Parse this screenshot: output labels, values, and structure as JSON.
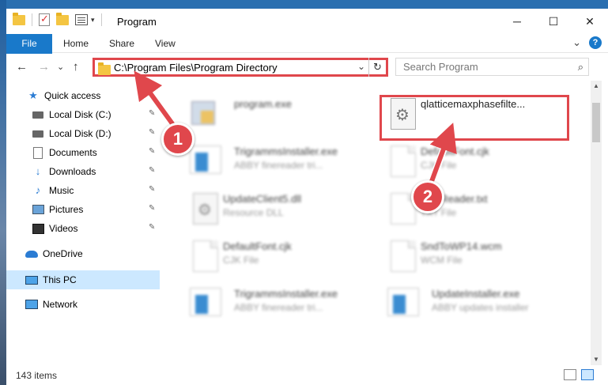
{
  "window": {
    "title": "Program",
    "minimize_label": "─",
    "maximize_label": "☐",
    "close_label": "✕"
  },
  "ribbon": {
    "tabs": [
      {
        "label": "File"
      },
      {
        "label": "Home"
      },
      {
        "label": "Share"
      },
      {
        "label": "View"
      }
    ],
    "expand_label": "⌄",
    "help_label": "?"
  },
  "nav": {
    "back": "←",
    "forward": "→",
    "recent": "⌄",
    "up": "↑"
  },
  "address": {
    "path": "C:\\Program Files\\Program Directory",
    "dropdown": "⌄",
    "refresh": "↻"
  },
  "search": {
    "placeholder": "Search Program",
    "icon": "⌕"
  },
  "sidebar": {
    "items": [
      {
        "label": "Quick access",
        "icon": "star-icon",
        "pinned": false
      },
      {
        "label": "Local Disk (C:)",
        "icon": "drive-icon",
        "pinned": true
      },
      {
        "label": "Local Disk (D:)",
        "icon": "drive-icon",
        "pinned": true
      },
      {
        "label": "Documents",
        "icon": "documents-icon",
        "pinned": true
      },
      {
        "label": "Downloads",
        "icon": "downloads-icon",
        "pinned": true
      },
      {
        "label": "Music",
        "icon": "music-icon",
        "pinned": true
      },
      {
        "label": "Pictures",
        "icon": "pictures-icon",
        "pinned": true
      },
      {
        "label": "Videos",
        "icon": "videos-icon",
        "pinned": true
      },
      {
        "label": "OneDrive",
        "icon": "onedrive-icon",
        "pinned": false
      },
      {
        "label": "This PC",
        "icon": "this-pc-icon",
        "pinned": false,
        "selected": true
      },
      {
        "label": "Network",
        "icon": "network-icon",
        "pinned": false
      }
    ],
    "pin_glyph": "📌"
  },
  "files": [
    {
      "name": "program.exe",
      "desc": "",
      "icon": "exe-icon",
      "blurred": true
    },
    {
      "name": "qlatticemaxphasefilte...",
      "desc": "",
      "icon": "gear-file-icon",
      "blurred": false,
      "highlighted": true
    },
    {
      "name": "TrigrammsInstaller.exe",
      "desc": "ABBY finereader tri...",
      "icon": "installer-icon",
      "blurred": true
    },
    {
      "name": "DefaultFont.cjk",
      "desc": "CJK File",
      "icon": "page-icon",
      "blurred": true
    },
    {
      "name": "UpdateClient5.dll",
      "desc": "Resource DLL",
      "icon": "gear-file-icon",
      "blurred": true
    },
    {
      "name": "FineReader.txt",
      "desc": "TXT File",
      "icon": "page-icon",
      "blurred": true
    },
    {
      "name": "DefaultFont.cjk",
      "desc": "CJK File",
      "icon": "page-icon",
      "blurred": true
    },
    {
      "name": "SndToWP14.wcm",
      "desc": "WCM File",
      "icon": "page-icon",
      "blurred": true
    },
    {
      "name": "TrigrammsInstaller.exe",
      "desc": "ABBY finereader tri...",
      "icon": "installer-icon",
      "blurred": true
    },
    {
      "name": "UpdateInstaller.exe",
      "desc": "ABBY updates installer",
      "icon": "installer-icon",
      "blurred": true
    }
  ],
  "status": {
    "item_count": "143 items"
  },
  "callouts": [
    {
      "label": "1"
    },
    {
      "label": "2"
    }
  ],
  "colors": {
    "accent": "#1979ca",
    "annotation_red": "#e0474c",
    "selection": "#cce8ff"
  }
}
